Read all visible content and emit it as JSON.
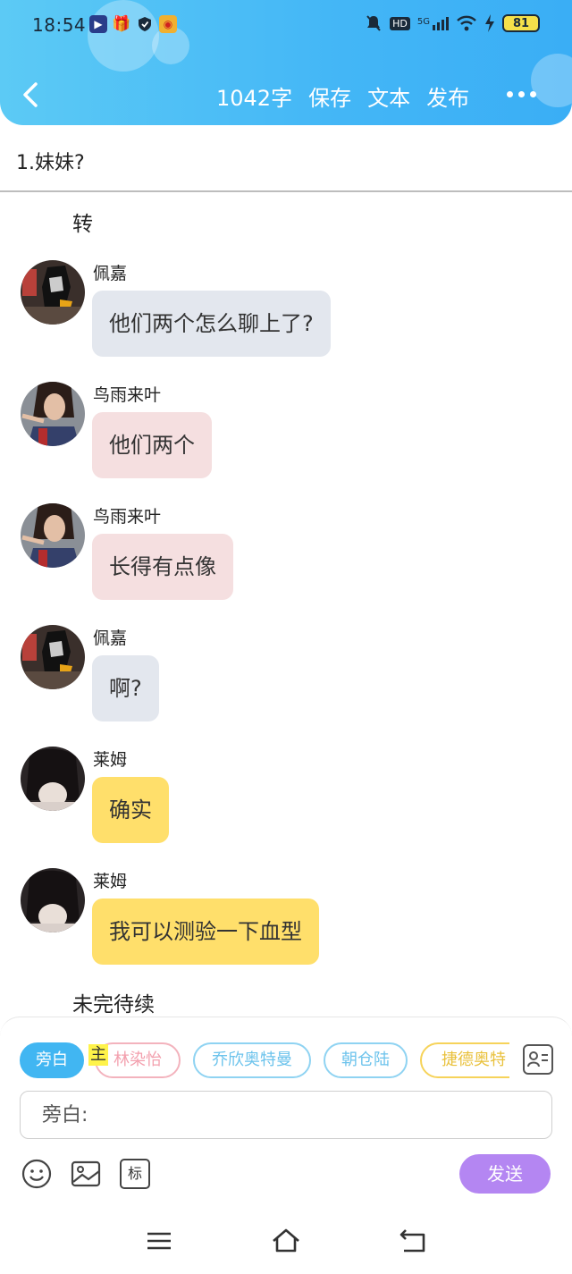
{
  "status_bar": {
    "time": "18:54",
    "network": "5G",
    "hd": "HD",
    "battery": "81"
  },
  "header": {
    "word_count": "1042字",
    "save": "保存",
    "text": "文本",
    "publish": "发布"
  },
  "chapter_title": "1.妹妹?",
  "chat": [
    {
      "type": "narration",
      "text": "转"
    },
    {
      "type": "message",
      "sender": "佩嘉",
      "text": "他们两个怎么聊上了?",
      "color": "#e3e7ee"
    },
    {
      "type": "message",
      "sender": "鸟雨来叶",
      "text": "他们两个",
      "color": "#f5dfe0"
    },
    {
      "type": "message",
      "sender": "鸟雨来叶",
      "text": "长得有点像",
      "color": "#f5dfe0"
    },
    {
      "type": "message",
      "sender": "佩嘉",
      "text": "啊?",
      "color": "#e3e7ee"
    },
    {
      "type": "message",
      "sender": "莱姆",
      "text": "确实",
      "color": "#ffdf6b"
    },
    {
      "type": "message",
      "sender": "莱姆",
      "text": "我可以测验一下血型",
      "color": "#ffdf6b"
    },
    {
      "type": "narration",
      "text": "未完待续"
    }
  ],
  "characters": {
    "active": "旁白",
    "main_tag": "主",
    "list": [
      {
        "name": "林染怡",
        "color": "#f3b3bd"
      },
      {
        "name": "乔欣奥特曼",
        "color": "#8fd3f2"
      },
      {
        "name": "朝仓陆",
        "color": "#8fd3f2"
      },
      {
        "name": "捷德奥特",
        "color": "#f6d35a"
      }
    ]
  },
  "input": {
    "placeholder": "旁白:"
  },
  "tools": {
    "mark_label": "标"
  },
  "send": "发送"
}
